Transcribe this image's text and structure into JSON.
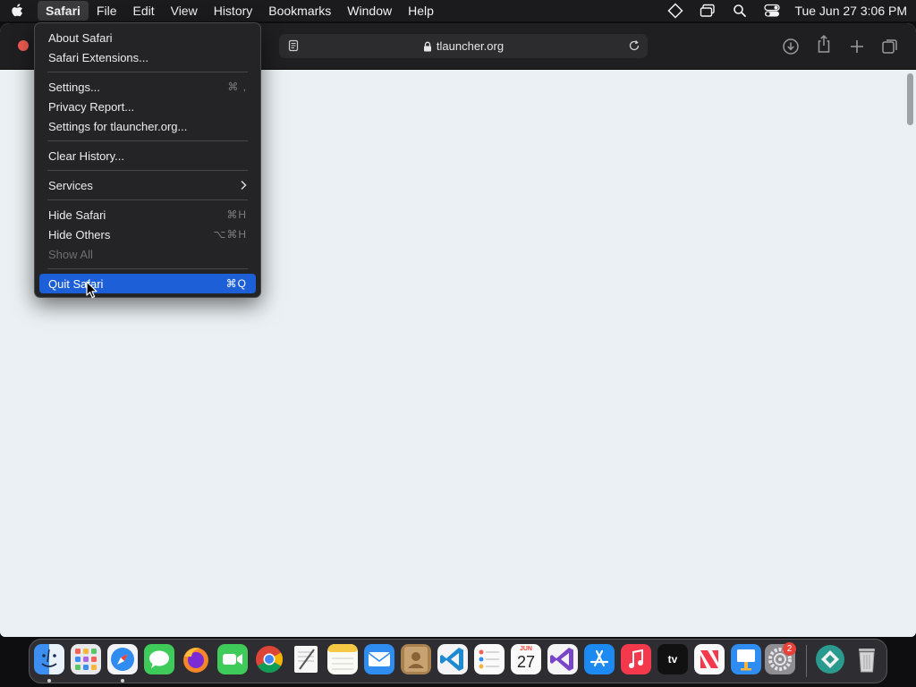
{
  "menubar": {
    "apple_icon": "apple-logo-icon",
    "items": [
      "Safari",
      "File",
      "Edit",
      "View",
      "History",
      "Bookmarks",
      "Window",
      "Help"
    ],
    "status_icons": [
      "diamond-icon",
      "screen-mirroring-icon",
      "spotlight-search-icon",
      "control-center-icon"
    ],
    "clock": "Tue Jun 27  3:06 PM"
  },
  "toolbar": {
    "url": "tlauncher.org",
    "icons": [
      "reader-icon",
      "lock-icon",
      "reload-icon",
      "downloads-icon",
      "share-icon",
      "new-tab-icon",
      "tab-overview-icon"
    ]
  },
  "safari_menu": {
    "items": [
      {
        "label": "About Safari",
        "shortcut": ""
      },
      {
        "label": "Safari Extensions...",
        "shortcut": ""
      },
      {
        "label": "Settings...",
        "shortcut": "⌘ ,"
      },
      {
        "label": "Privacy Report...",
        "shortcut": ""
      },
      {
        "label": "Settings for tlauncher.org...",
        "shortcut": ""
      },
      {
        "label": "Clear History...",
        "shortcut": ""
      },
      {
        "label": "Services",
        "shortcut": ""
      },
      {
        "label": "Hide Safari",
        "shortcut": "⌘H"
      },
      {
        "label": "Hide Others",
        "shortcut": "⌥⌘H"
      },
      {
        "label": "Show All",
        "shortcut": ""
      },
      {
        "label": "Quit Safari",
        "shortcut": "⌘Q"
      }
    ],
    "highlighted": "Quit Safari",
    "disabled": "Show All",
    "highlight_color": "#1d5fd6"
  },
  "dock": {
    "apps": [
      "Finder",
      "Launchpad",
      "Safari",
      "Messages",
      "Firefox",
      "FaceTime",
      "Chrome",
      "TextEdit",
      "Notes",
      "Mail",
      "Contacts",
      "Visual Studio Code",
      "Reminders",
      "Calendar",
      "Visual Studio",
      "App Store",
      "Music",
      "Apple TV",
      "News",
      "Keynote",
      "System Settings",
      "Download Manager",
      "Trash"
    ],
    "calendar_month": "JUN",
    "calendar_day": "27",
    "tv_label": "tv",
    "settings_badge": "2"
  },
  "colors": {
    "menubar": "#1b1b1d",
    "page_background": "#eaf0f3",
    "close_button": "#ee5b52",
    "menu_background": "#242426"
  }
}
